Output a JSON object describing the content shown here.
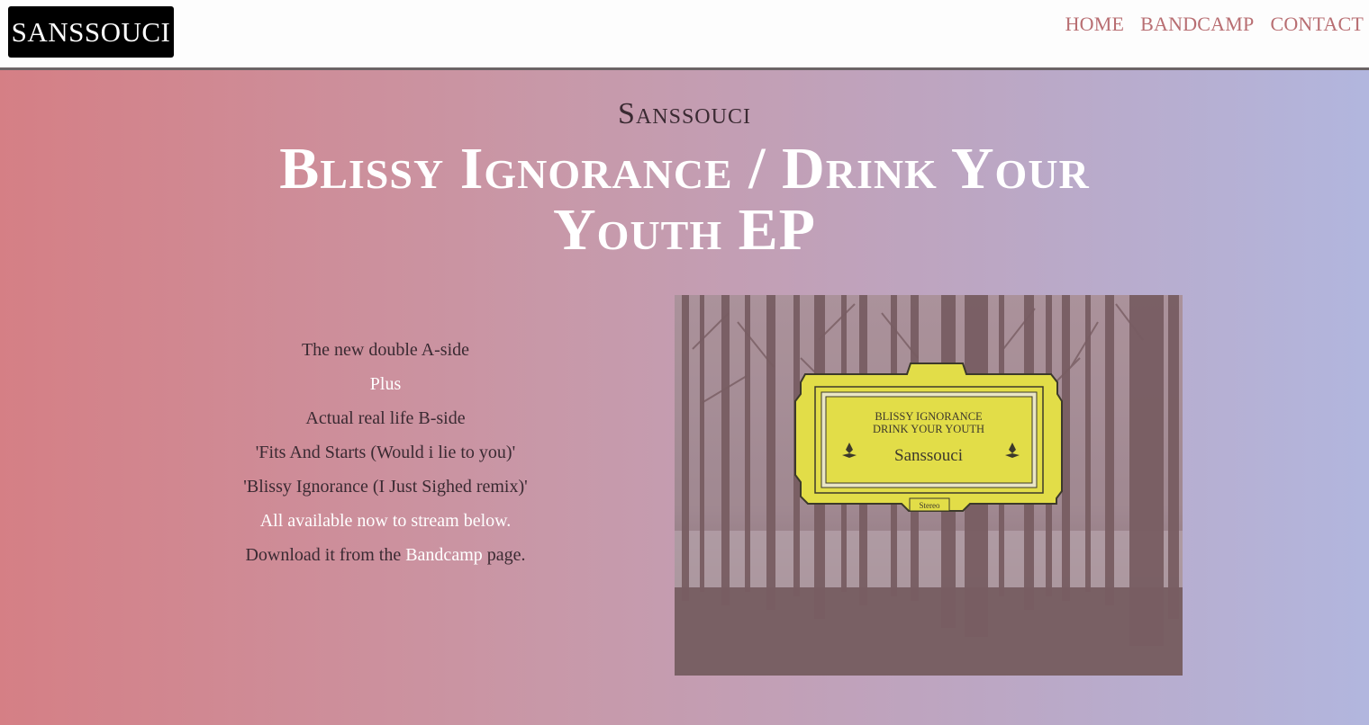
{
  "nav": {
    "brand": "SANSSOUCI",
    "links": [
      "HOME",
      "BANDCAMP",
      "CONTACT"
    ]
  },
  "hero": {
    "artist": "Sanssouci",
    "title": "Blissy Ignorance / Drink Your Youth EP",
    "lines": {
      "l1": "The new double A-side",
      "l2": "Plus",
      "l3": "Actual real life B-side",
      "l4": "'Fits And Starts (Would i lie to you)'",
      "l5": "'Blissy Ignorance (I Just Sighed remix)'",
      "l6": "All available now to stream below.",
      "l7_pre": "Download it from the",
      "l7_link": "Bandcamp",
      "l7_post": "page."
    }
  },
  "cover": {
    "line1": "BLISSY IGNORANCE",
    "line2": "DRINK YOUR YOUTH",
    "artist": "Sanssouci",
    "stereo": "Stereo",
    "label_color": "#e8e83a"
  },
  "colors": {
    "gradient_left": "#d57f85",
    "gradient_right": "#b2b6de",
    "nav_link": "#b86e72"
  }
}
